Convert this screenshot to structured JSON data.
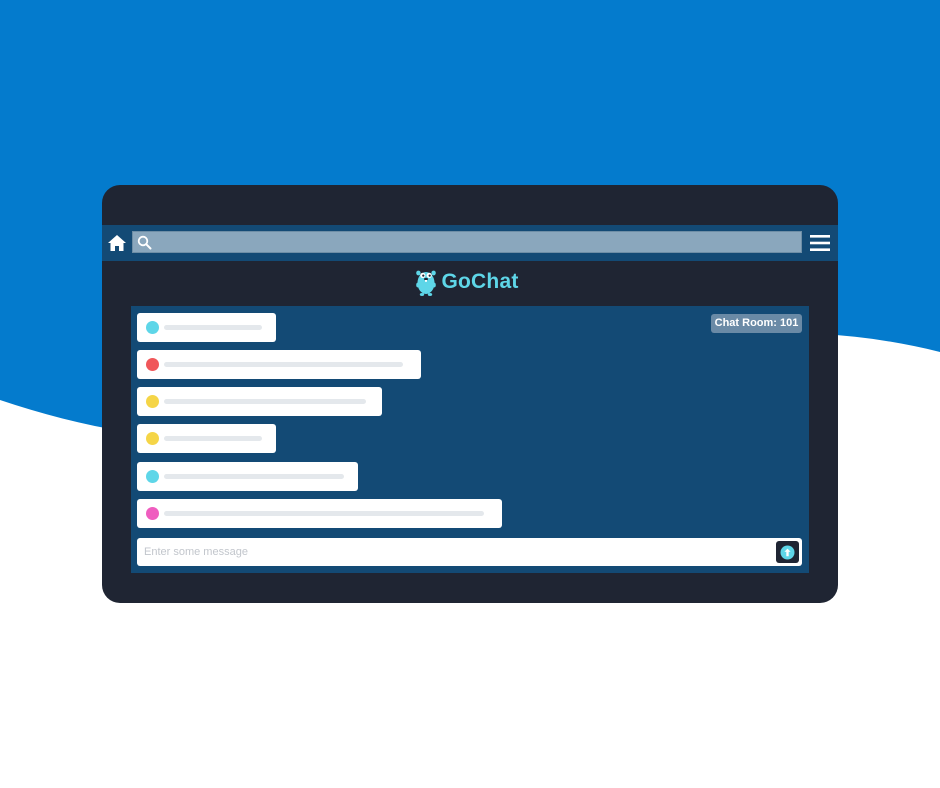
{
  "app": {
    "name": "GoChat",
    "logo_icon": "gopher-mascot-icon",
    "brand_color": "#5ed6e8"
  },
  "colors": {
    "page_background_top": "#047bcd",
    "page_background_bottom": "#ffffff",
    "device_frame": "#1f2533",
    "toolbar": "#134a75",
    "search_bar": "#8aa7bd",
    "room_badge": "#6a8aa6"
  },
  "toolbar": {
    "home_icon": "home-icon",
    "search_icon": "search-icon",
    "search_value": "",
    "menu_icon": "hamburger-menu-icon"
  },
  "chat": {
    "room_label": "Chat Room: 101",
    "messages": [
      {
        "avatar_color": "#5ed6e8",
        "text": ""
      },
      {
        "avatar_color": "#f0575a",
        "text": ""
      },
      {
        "avatar_color": "#f5d547",
        "text": ""
      },
      {
        "avatar_color": "#f5d547",
        "text": ""
      },
      {
        "avatar_color": "#5ed6e8",
        "text": ""
      },
      {
        "avatar_color": "#ef5dbf",
        "text": ""
      }
    ]
  },
  "composer": {
    "placeholder": "Enter some message",
    "value": "",
    "send_icon": "send-arrow-up-icon"
  }
}
